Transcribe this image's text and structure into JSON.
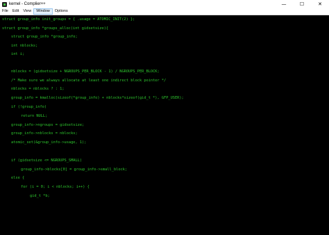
{
  "window": {
    "title": "kernel - Complier++",
    "minimize_glyph": "—",
    "maximize_glyph": "☐",
    "close_glyph": "✕"
  },
  "menu": {
    "items": [
      "File",
      "Edit",
      "View",
      "Window",
      "Options"
    ],
    "active": "Window"
  },
  "colors": {
    "code_text": "#2ec82e",
    "editor_background": "#000000"
  },
  "code": {
    "lines": [
      "struct group_info init_groups = { .usage = ATOMIC_INIT(2) };",
      "struct group_info *groups_alloc(int gidsetsize){",
      "struct group_info *group_info;",
      "int nblocks;",
      "int i;",
      "",
      "nblocks = (gidsetsize + NGROUPS_PER_BLOCK - 1) / NGROUPS_PER_BLOCK;",
      "/* Make sure we always allocate at least one indirect block pointer */",
      "nblocks = nblocks ? : 1;",
      "group_info = kmalloc(sizeof(*group_info) + nblocks*sizeof(gid_t *), GFP_USER);",
      "if (!group_info)",
      "return NULL;",
      "group_info->ngroups = gidsetsize;",
      "group_info->nblocks = nblocks;",
      "atomic_set(&group_info->usage, 1);",
      "",
      "if (gidsetsize <= NGROUPS_SMALL)",
      "group_info->blocks[0] = group_info->small_block;",
      "else {",
      "for (i = 0; i < nblocks; i++) {",
      "gid_t *b;"
    ]
  }
}
